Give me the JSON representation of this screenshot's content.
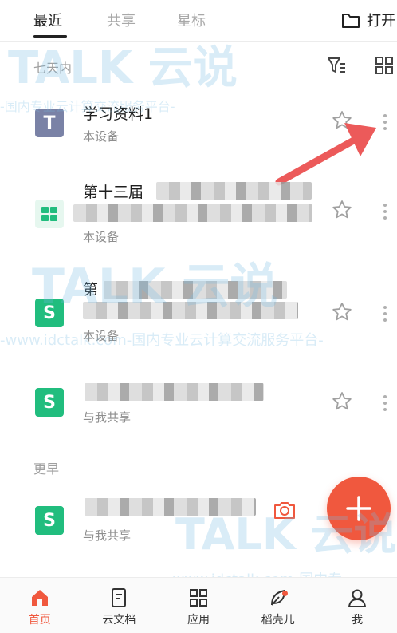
{
  "tabs": [
    {
      "label": "最近",
      "active": true
    },
    {
      "label": "共享",
      "active": false
    },
    {
      "label": "星标",
      "active": false
    }
  ],
  "open_label": "打开",
  "sections": {
    "recent": "七天内",
    "earlier": "更早"
  },
  "files": [
    {
      "name": "学习资料1",
      "source": "本设备",
      "icon": "word-doc-icon",
      "icon_glyph": "T"
    },
    {
      "name": "第十三届",
      "source": "本设备",
      "icon": "sheet-icon",
      "icon_glyph": ""
    },
    {
      "name": "第",
      "source": "本设备",
      "icon": "spreadsheet-s-icon",
      "icon_glyph": "S"
    },
    {
      "name": "",
      "source": "与我共享",
      "icon": "spreadsheet-s-icon",
      "icon_glyph": "S"
    },
    {
      "name": "",
      "source": "与我共享",
      "icon": "spreadsheet-s-icon",
      "icon_glyph": "S"
    }
  ],
  "watermarks": {
    "brand": "TALK 云说",
    "line": "-www.idctalk.com-国内专业云计算交流服务平台-",
    "line_short": "-国内专业云计算交流服务平台-",
    "line_bottom": "-www.idctalk.com-国内专"
  },
  "nav": [
    {
      "label": "首页",
      "active": true
    },
    {
      "label": "云文档",
      "active": false
    },
    {
      "label": "应用",
      "active": false
    },
    {
      "label": "稻壳儿",
      "active": false
    },
    {
      "label": "我",
      "active": false
    }
  ],
  "colors": {
    "accent": "#f0583e",
    "sheet_green": "#21bd7e",
    "word_gray": "#7a82a6"
  }
}
